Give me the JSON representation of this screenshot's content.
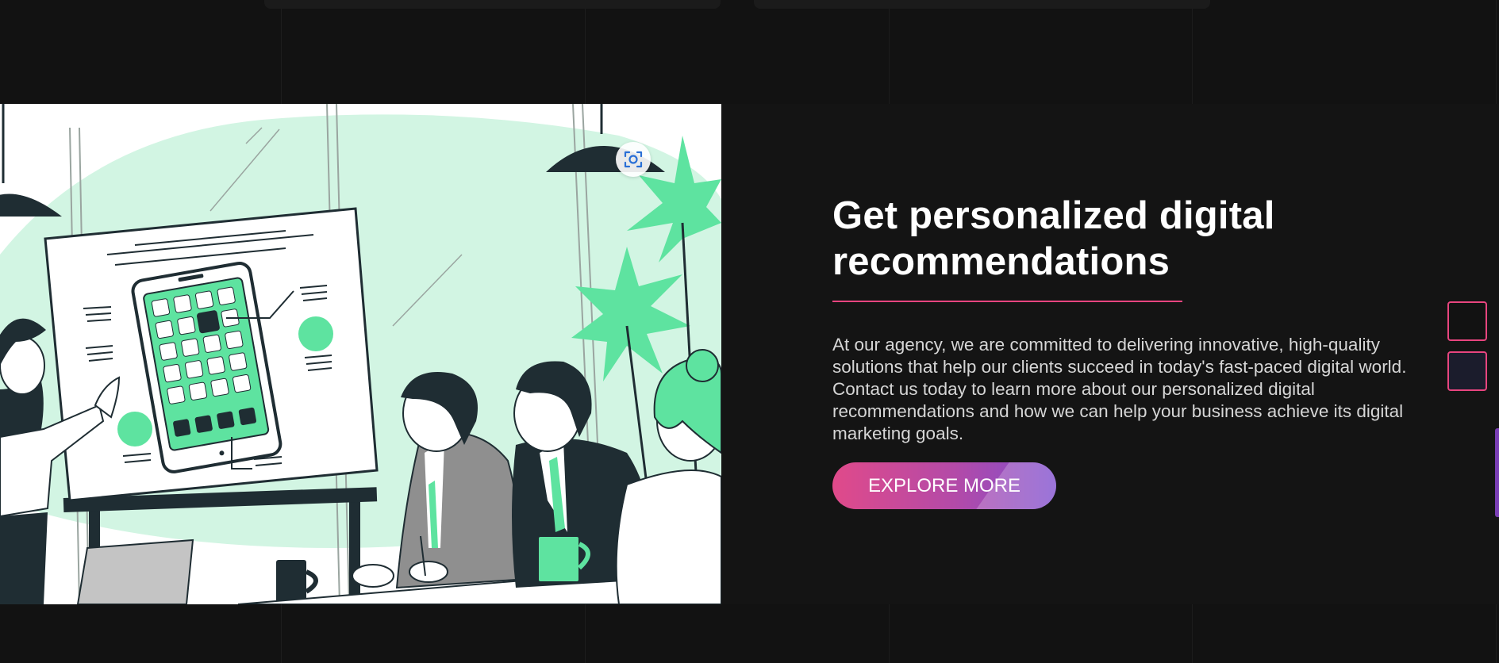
{
  "hero": {
    "title_line1": "Get personalized digital",
    "title_line2": "recommendations",
    "description": "At our agency, we are committed to delivering innovative, high-quality solutions that help our clients succeed in today's fast-paced digital world. Contact us today to learn more about our personalized digital recommendations and how we can help your business achieve its digital marketing goals.",
    "button_label": "EXPLORE MORE"
  },
  "icons": {
    "scan": "visual-search-icon"
  },
  "colors": {
    "background": "#121212",
    "accent_pink": "#e8457f",
    "button_gradient_start": "#e04a8a",
    "button_gradient_end": "#7e4ecf",
    "illustration_green": "#5ee3a0"
  }
}
